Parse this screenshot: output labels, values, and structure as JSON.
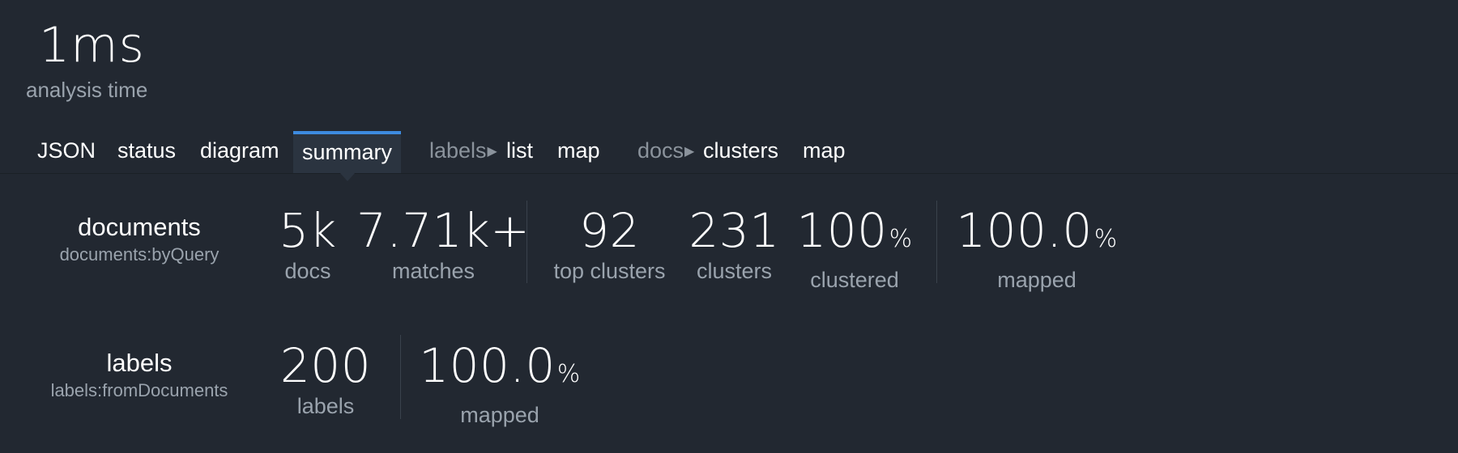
{
  "analysis": {
    "time_value": "1ms",
    "time_label": "analysis time"
  },
  "tabs": {
    "json": "JSON",
    "status": "status",
    "diagram": "diagram",
    "summary": "summary",
    "labels_group": "labels",
    "labels_list": "list",
    "labels_map": "map",
    "docs_group": "docs",
    "docs_clusters": "clusters",
    "docs_map": "map",
    "group_arrow": "▶"
  },
  "documents": {
    "title": "documents",
    "subtitle": "documents:byQuery",
    "docs": {
      "value": "5k",
      "label": "docs"
    },
    "matches": {
      "value": "7.71k+",
      "label": "matches"
    },
    "top_clusters": {
      "value": "92",
      "label": "top clusters"
    },
    "clusters": {
      "value": "231",
      "label": "clusters"
    },
    "clustered": {
      "value": "100",
      "unit": "%",
      "label": "clustered"
    },
    "mapped": {
      "value": "100.0",
      "unit": "%",
      "label": "mapped"
    }
  },
  "labels": {
    "title": "labels",
    "subtitle": "labels:fromDocuments",
    "labels": {
      "value": "200",
      "label": "labels"
    },
    "mapped": {
      "value": "100.0",
      "unit": "%",
      "label": "mapped"
    }
  },
  "colors": {
    "background": "#222831",
    "active_tab_accent": "#3d8be0",
    "active_tab_bg": "#2b3440",
    "muted_text": "#9aa3ad"
  }
}
